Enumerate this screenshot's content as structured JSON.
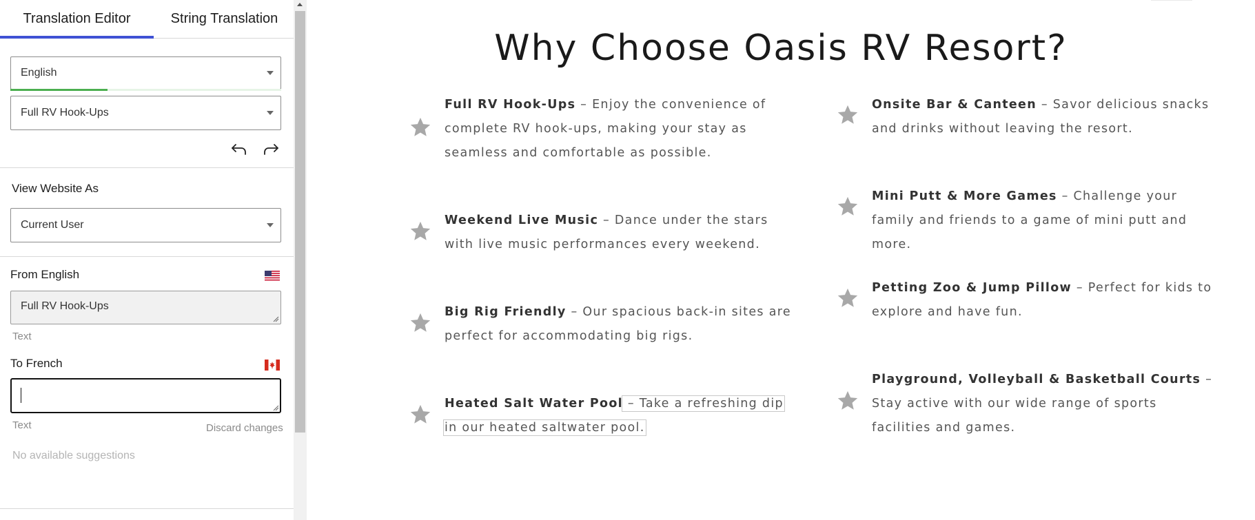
{
  "editor": {
    "tabs": [
      {
        "label": "Translation Editor",
        "active": true
      },
      {
        "label": "String Translation",
        "active": false
      }
    ],
    "language_select": {
      "value": "English",
      "progress_percent": 36
    },
    "string_select": {
      "value": "Full RV Hook-Ups"
    },
    "view_as": {
      "title": "View Website As",
      "value": "Current User"
    },
    "from": {
      "title": "From English",
      "text": "Full RV Hook-Ups",
      "type": "Text",
      "flag": "us-flag-icon"
    },
    "to": {
      "title": "To French",
      "text": "",
      "type": "Text",
      "flag": "canada-flag-icon",
      "discard_label": "Discard changes"
    },
    "suggestions": "No available suggestions",
    "colors": {
      "tab_accent": "#3f51d4",
      "progress": "#4caf50"
    }
  },
  "site": {
    "title": "Why Choose Oasis RV Resort?",
    "features": [
      {
        "name": "Full RV Hook-Ups",
        "desc": " – Enjoy the convenience of complete RV hook-ups, making your stay as seamless and comfortable as possible."
      },
      {
        "name": "Weekend Live Music",
        "desc": " – Dance under the stars with live music performances every weekend."
      },
      {
        "name": "Big Rig Friendly",
        "desc": " – Our spacious back-in sites are perfect for accommodating big rigs."
      },
      {
        "name": "Heated Salt Water Pool",
        "desc": " – Take a refreshing dip in our heated saltwater pool."
      },
      {
        "name": "Onsite Bar & Canteen",
        "desc": " – Savor delicious snacks and drinks without leaving the resort."
      },
      {
        "name": "Mini Putt & More Games",
        "desc": " – Challenge your family and friends to a game of mini putt and more."
      },
      {
        "name": "Petting Zoo & Jump Pillow",
        "desc": " – Perfect for kids to explore and have fun."
      },
      {
        "name": "Playground, Volleyball & Basketball Courts",
        "desc": " – Stay active with our wide range of sports facilities and games."
      }
    ],
    "icon": "star-icon",
    "star_color": "#a8a8a8"
  }
}
